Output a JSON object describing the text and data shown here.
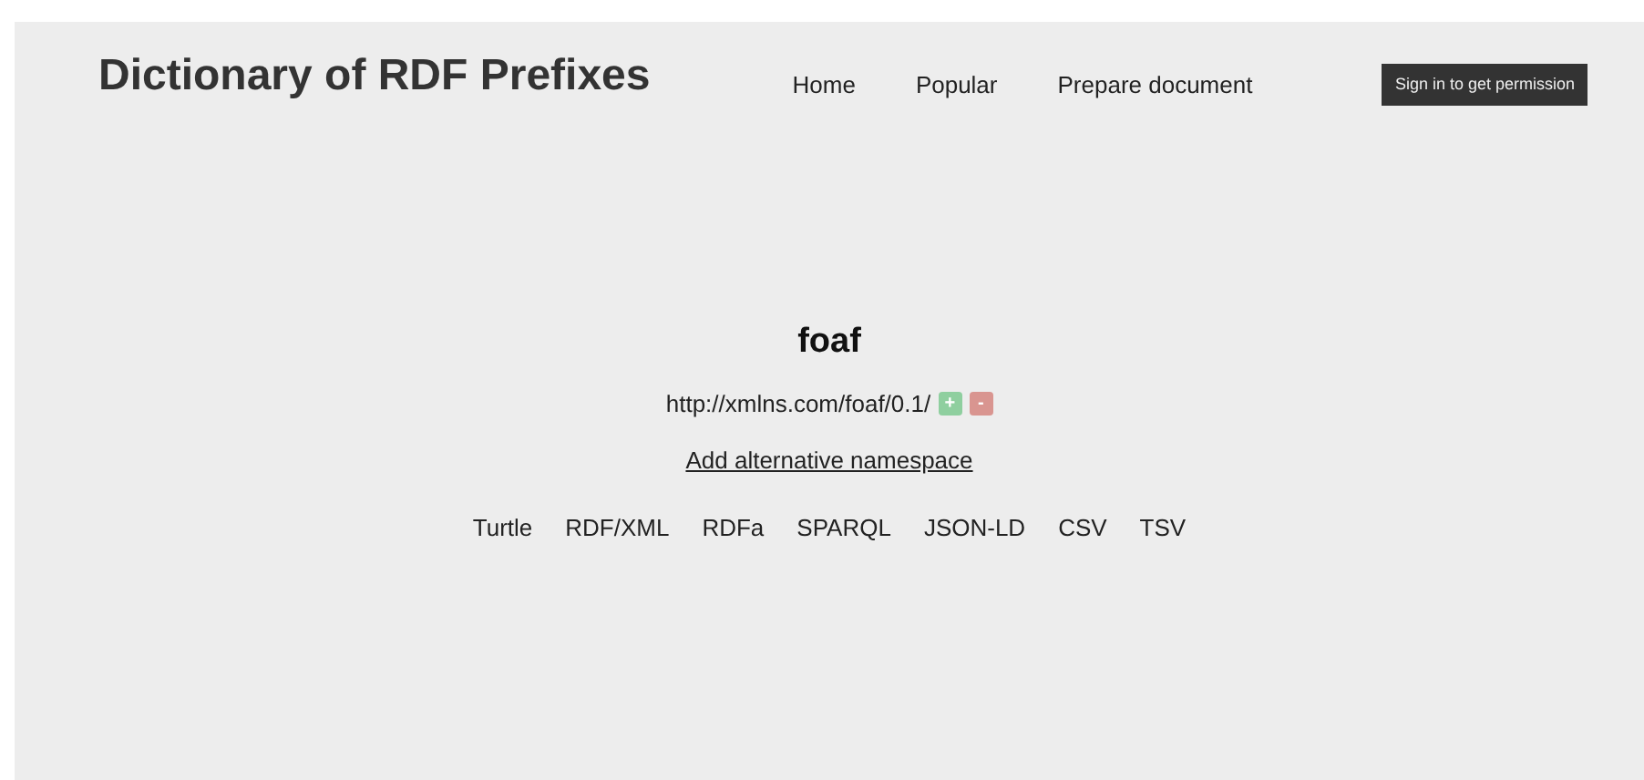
{
  "site_title": "Dictionary of RDF Prefixes",
  "nav": [
    "Home",
    "Popular",
    "Prepare document"
  ],
  "sign_in_button": "Sign in to get permission",
  "prefix": "foaf",
  "namespace": {
    "uri": "http://xmlns.com/foaf/0.1/",
    "upvote": "+",
    "downvote": "-"
  },
  "add_alternative_link": "Add alternative namespace",
  "formats": [
    "Turtle",
    "RDF/XML",
    "RDFa",
    "SPARQL",
    "JSON-LD",
    "CSV",
    "TSV"
  ]
}
